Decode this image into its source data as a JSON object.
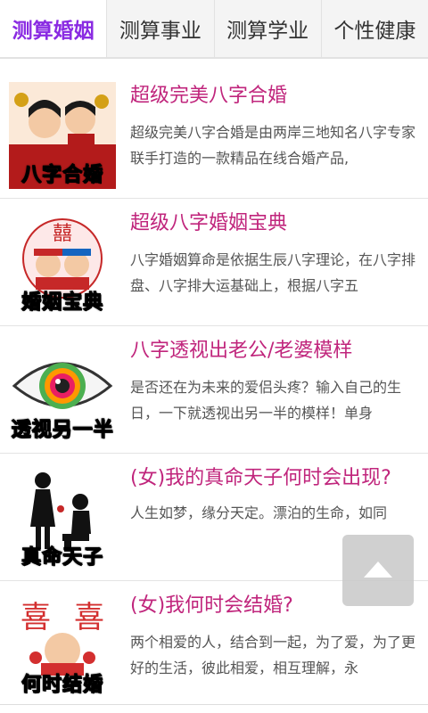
{
  "tabs": [
    {
      "label": "测算婚姻",
      "active": true
    },
    {
      "label": "测算事业",
      "active": false
    },
    {
      "label": "测算学业",
      "active": false
    },
    {
      "label": "个性健康",
      "active": false
    }
  ],
  "items": [
    {
      "title": "超级完美八字合婚",
      "desc": "超级完美八字合婚是由两岸三地知名八字专家联手打造的一款精品在线合婚产品,",
      "thumb_caption": "八字合婚"
    },
    {
      "title": "超级八字婚姻宝典",
      "desc": "八字婚姻算命是依据生辰八字理论，在八字排盘、八字排大运基础上，根据八字五",
      "thumb_caption": "婚姻宝典"
    },
    {
      "title": "八字透视出老公/老婆模样",
      "desc": "是否还在为未来的爱侣头疼？输入自己的生日，一下就透视出另一半的模样！单身",
      "thumb_caption": "透视另一半"
    },
    {
      "title": "(女)我的真命天子何时会出现?",
      "desc": "人生如梦，缘分天定。漂泊的生命，如同",
      "thumb_caption": "真命天子"
    },
    {
      "title": "(女)我何时会结婚?",
      "desc": "两个相爱的人，结合到一起，为了爱，为了更好的生活，彼此相爱，相互理解，永",
      "thumb_caption": "何时结婚"
    }
  ],
  "colors": {
    "accent": "#8a2be2",
    "title": "#c0257c"
  },
  "fab": {
    "icon": "scroll-to-top-icon"
  }
}
